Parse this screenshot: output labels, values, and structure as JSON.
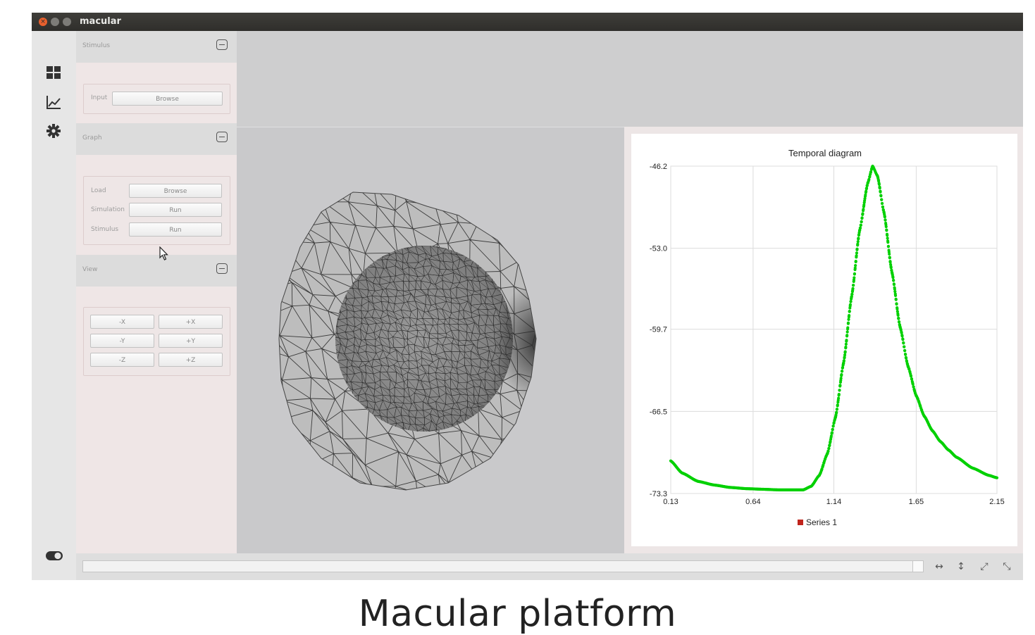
{
  "window": {
    "title": "macular"
  },
  "iconbar": {
    "items": [
      {
        "icon": "dashboard-grid-icon"
      },
      {
        "icon": "line-chart-icon"
      },
      {
        "icon": "gear-icon"
      }
    ],
    "toggle_icon": "toggle-switch-icon"
  },
  "panel": {
    "stimulus": {
      "title": "Stimulus",
      "input_label": "Input",
      "browse_label": "Browse"
    },
    "graph": {
      "title": "Graph",
      "load_label": "Load",
      "load_button": "Browse",
      "simulation_label": "Simulation",
      "simulation_button": "Run",
      "stimulus_label": "Stimulus",
      "stimulus_button": "Run"
    },
    "view": {
      "title": "View",
      "minus_x": "-X",
      "plus_x": "+X",
      "minus_y": "-Y",
      "plus_y": "+Y",
      "minus_z": "-Z",
      "plus_z": "+Z"
    }
  },
  "progress": {
    "fraction": 0.0
  },
  "toolbar": {
    "icons": [
      "horizontal-arrows-icon",
      "vertical-arrows-icon",
      "expand-icon",
      "collapse-icon"
    ]
  },
  "colors": {
    "series": "#00d000",
    "legend_marker": "#c0241c",
    "accent": "#e8602d"
  },
  "chart_data": {
    "type": "scatter",
    "title": "Temporal diagram",
    "xlabel": "",
    "ylabel": "",
    "xlim": [
      0.13,
      2.15
    ],
    "ylim": [
      -73.3,
      -46.2
    ],
    "x_ticks": [
      "0.13",
      "0.64",
      "1.14",
      "1.65",
      "2.15"
    ],
    "y_ticks": [
      "-46.2",
      "-53.0",
      "-59.7",
      "-66.5",
      "-73.3"
    ],
    "grid": true,
    "legend": {
      "placement": "bottom-center",
      "entries": [
        "Series 1"
      ]
    },
    "series": [
      {
        "name": "Series 1",
        "points": [
          [
            0.13,
            -70.6
          ],
          [
            0.2,
            -71.6
          ],
          [
            0.3,
            -72.3
          ],
          [
            0.4,
            -72.6
          ],
          [
            0.5,
            -72.8
          ],
          [
            0.6,
            -72.9
          ],
          [
            0.7,
            -72.95
          ],
          [
            0.8,
            -73.0
          ],
          [
            0.9,
            -73.0
          ],
          [
            0.95,
            -73.0
          ],
          [
            1.0,
            -72.7
          ],
          [
            1.05,
            -71.8
          ],
          [
            1.1,
            -70.0
          ],
          [
            1.15,
            -67.0
          ],
          [
            1.2,
            -62.5
          ],
          [
            1.25,
            -57.0
          ],
          [
            1.3,
            -51.5
          ],
          [
            1.35,
            -47.6
          ],
          [
            1.38,
            -46.2
          ],
          [
            1.41,
            -47.0
          ],
          [
            1.45,
            -50.0
          ],
          [
            1.5,
            -55.0
          ],
          [
            1.55,
            -59.5
          ],
          [
            1.6,
            -62.8
          ],
          [
            1.65,
            -65.2
          ],
          [
            1.7,
            -66.9
          ],
          [
            1.75,
            -68.1
          ],
          [
            1.8,
            -69.0
          ],
          [
            1.85,
            -69.7
          ],
          [
            1.9,
            -70.3
          ],
          [
            2.0,
            -71.2
          ],
          [
            2.1,
            -71.8
          ],
          [
            2.15,
            -72.0
          ]
        ]
      }
    ]
  },
  "caption": "Macular platform"
}
